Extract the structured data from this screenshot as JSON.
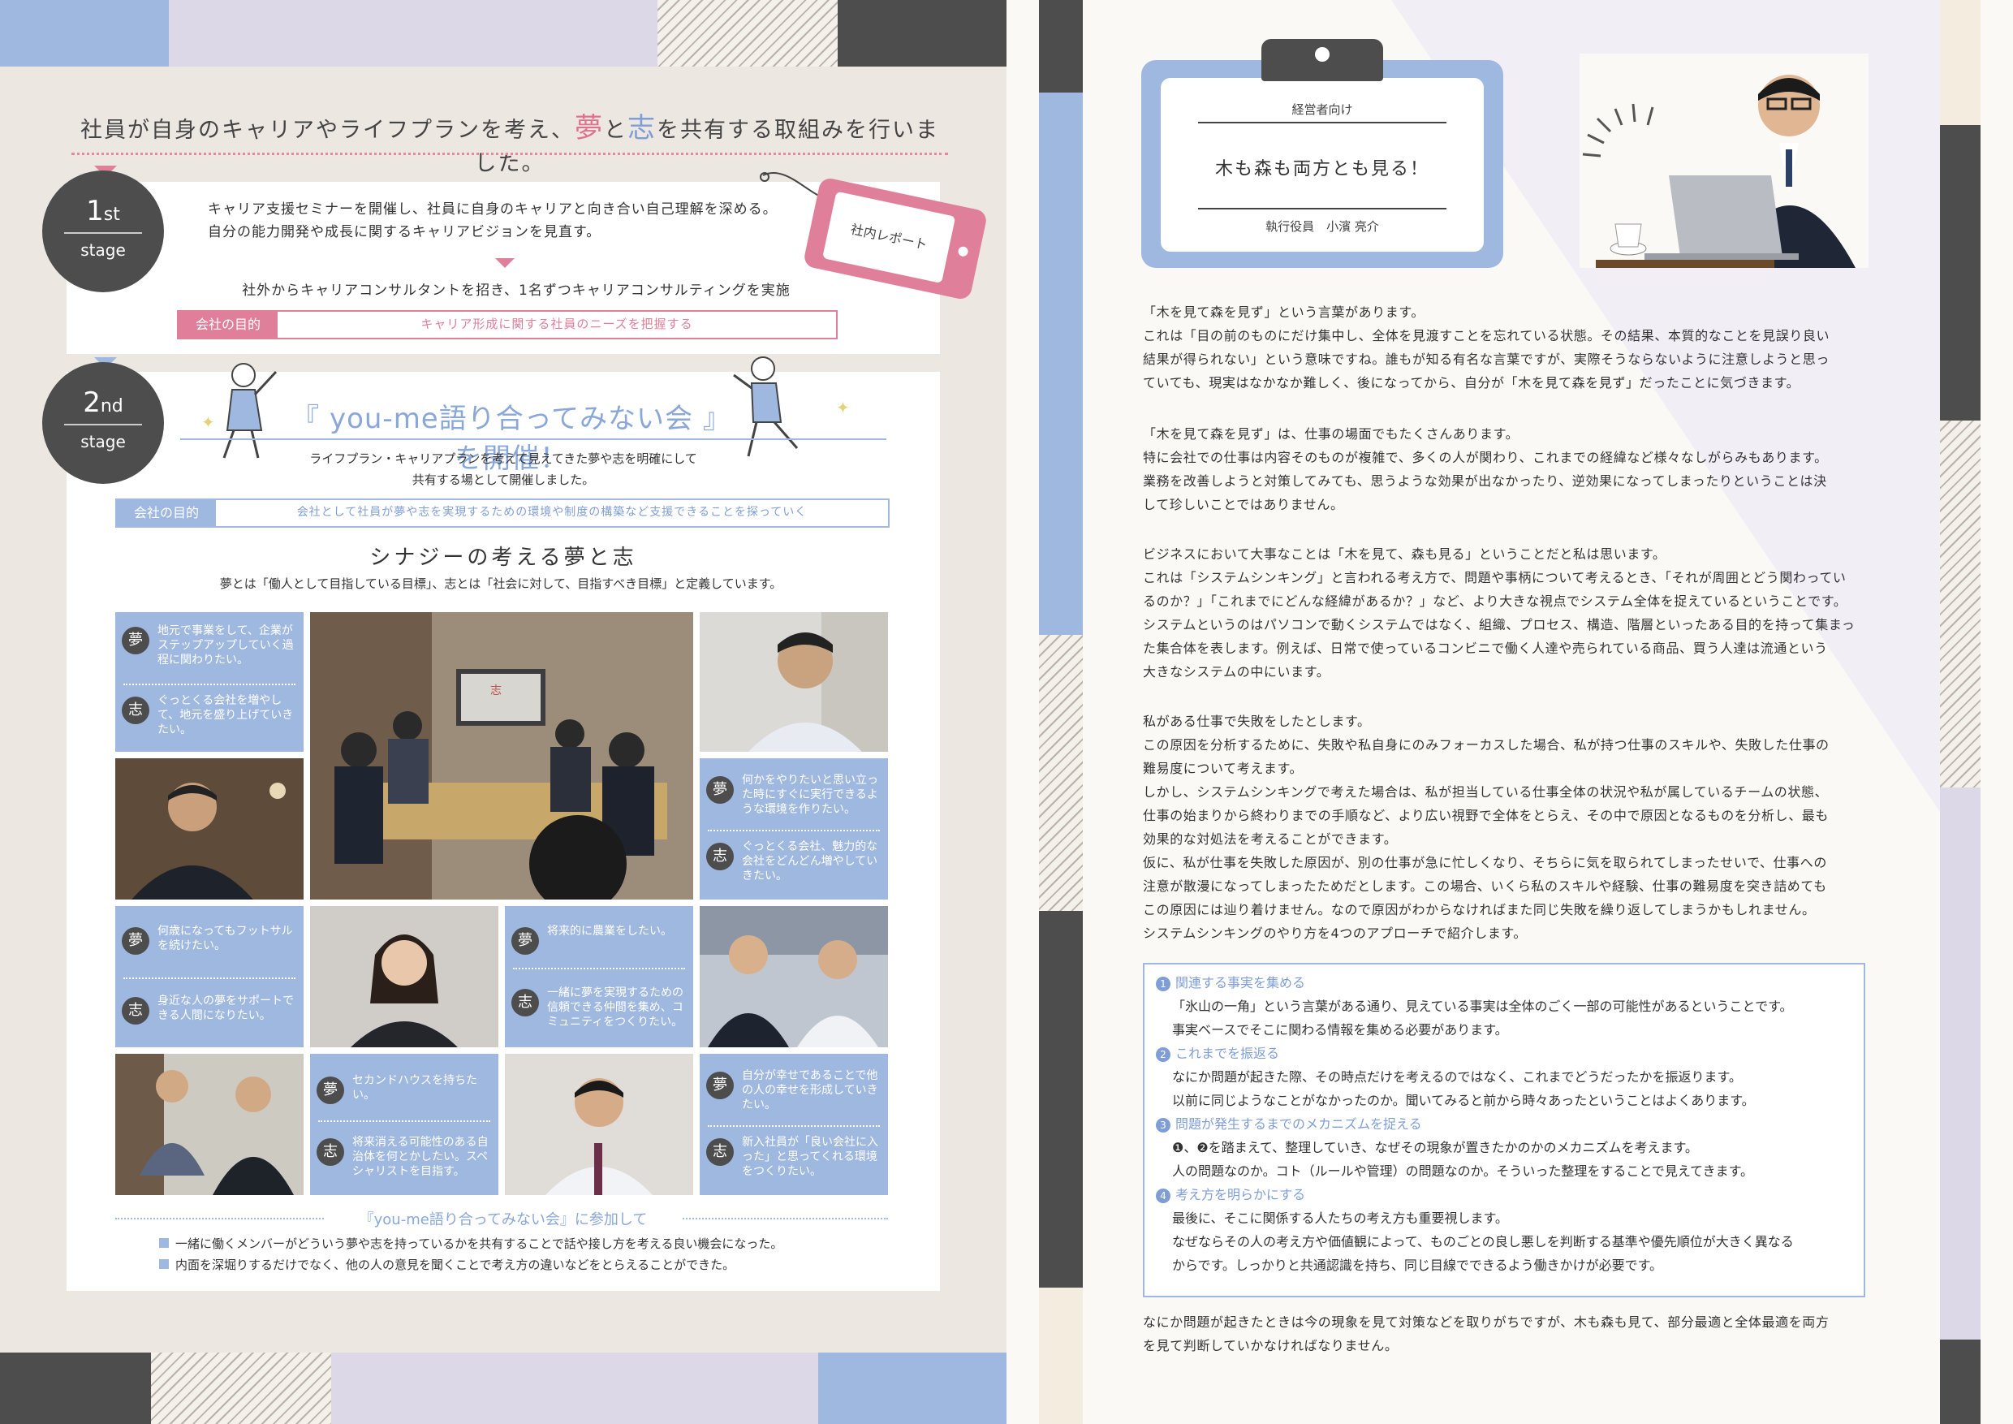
{
  "left": {
    "heading": {
      "pre": "社員が自身のキャリアやライフプランを考え、",
      "yume": "夢",
      "to": "と",
      "kokorozashi": "志",
      "post": "を共有する取組みを行いました。"
    },
    "stage1": {
      "num": "1",
      "suffix": "st",
      "label": "stage",
      "lines": [
        "キャリア支援セミナーを開催し、社員に自身のキャリアと向き合い自己理解を深める。",
        "自分の能力開発や成長に関するキャリアビジョンを見直す。"
      ],
      "sub": "社外からキャリアコンサルタントを招き、1名ずつキャリアコンサルティングを実施",
      "purpose_label": "会社の目的",
      "purpose_value": "キャリア形成に関する社員のニーズを把握する",
      "tag": "社内レポート"
    },
    "stage2": {
      "num": "2",
      "suffix": "nd",
      "label": "stage",
      "title": "『 you-me語り合ってみない会 』を開催！",
      "lines": [
        "ライフプラン・キャリアプランを考えて見えてきた夢や志を明確にして",
        "共有する場として開催しました。"
      ],
      "purpose_label": "会社の目的",
      "purpose_value": "会社として社員が夢や志を実現するための環境や制度の構築など支援できることを探っていく",
      "synergy": "シナジーの考える夢と志",
      "definition": "夢とは「働人として目指している目標」、志とは「社会に対して、目指すべき目標」と定義しています。"
    },
    "cards": [
      {
        "yume": "地元で事業をして、企業がステップアップしていく過程に関わりたい。",
        "shi": "ぐっとくる会社を増やして、地元を盛り上げていきたい。"
      },
      {
        "yume": "何かをやりたいと思い立った時にすぐに実行できるような環境を作りたい。",
        "shi": "ぐっとくる会社、魅力的な会社をどんどん増やしていきたい。"
      },
      {
        "yume": "何歳になってもフットサルを続けたい。",
        "shi": "身近な人の夢をサポートできる人間になりたい。"
      },
      {
        "yume": "将来的に農業をしたい。",
        "shi": "一緒に夢を実現するための信頼できる仲間を集め、コミュニティをつくりたい。"
      },
      {
        "yume": "セカンドハウスを持ちたい。",
        "shi": "将来消える可能性のある自治体を何とかしたい。スペシャリストを目指す。"
      },
      {
        "yume": "自分が幸せであることで他の人の幸せを形成していきたい。",
        "shi": "新入社員が「良い会社に入った」と思ってくれる環境をつくりたい。"
      }
    ],
    "badge_yume": "夢",
    "badge_shi": "志",
    "photo_chars": {
      "tv": "志"
    },
    "feedback": {
      "title": "『you-me語り合ってみない会』に参加して",
      "items": [
        "一緒に働くメンバーがどういう夢や志を持っているかを共有することで話や接し方を考える良い機会になった。",
        "内面を深堀りするだけでなく、他の人の意見を聞くことで考え方の違いなどをとらえることができた。"
      ]
    }
  },
  "right": {
    "card": {
      "category": "経営者向け",
      "title": "木も森も両方とも見る！",
      "author": "執行役員　小濱 亮介"
    },
    "paragraphs": [
      [
        "「木を見て森を見ず」という言葉があります。",
        "これは「目の前のものにだけ集中し、全体を見渡すことを忘れている状態。その結果、本質的なことを見誤り良い",
        "結果が得られない」という意味ですね。誰もが知る有名な言葉ですが、実際そうならないように注意しようと思っ",
        "ていても、現実はなかなか難しく、後になってから、自分が「木を見て森を見ず」だったことに気づきます。"
      ],
      [
        "「木を見て森を見ず」は、仕事の場面でもたくさんあります。",
        "特に会社での仕事は内容そのものが複雑で、多くの人が関わり、これまでの経緯など様々なしがらみもあります。",
        "業務を改善しようと対策してみても、思うような効果が出なかったり、逆効果になってしまったりということは決",
        "して珍しいことではありません。"
      ],
      [
        "ビジネスにおいて大事なことは「木を見て、森も見る」ということだと私は思います。",
        "これは「システムシンキング」と言われる考え方で、問題や事柄について考えるとき、「それが周囲とどう関わってい",
        "るのか？」「これまでにどんな経緯があるか？」など、より大きな視点でシステム全体を捉えているということです。",
        "システムというのはパソコンで動くシステムではなく、組織、プロセス、構造、階層といったある目的を持って集まっ",
        "た集合体を表します。例えば、日常で使っているコンビニで働く人達や売られている商品、買う人達は流通という",
        "大きなシステムの中にいます。"
      ],
      [
        "私がある仕事で失敗をしたとします。",
        "この原因を分析するために、失敗や私自身にのみフォーカスした場合、私が持つ仕事のスキルや、失敗した仕事の",
        "難易度について考えます。",
        "しかし、システムシンキングで考えた場合は、私が担当している仕事全体の状況や私が属しているチームの状態、",
        "仕事の始まりから終わりまでの手順など、より広い視野で全体をとらえ、その中で原因となるものを分析し、最も",
        "効果的な対処法を考えることができます。",
        "仮に、私が仕事を失敗した原因が、別の仕事が急に忙しくなり、そちらに気を取られてしまったせいで、仕事への",
        "注意が散漫になってしまったためだとします。この場合、いくら私のスキルや経験、仕事の難易度を突き詰めても",
        "この原因には辿り着けません。なので原因がわからなければまた同じ失敗を繰り返してしまうかもしれません。",
        "システムシンキングのやり方を4つのアプローチで紹介します。"
      ]
    ],
    "approaches": [
      {
        "n": "1",
        "title": "関連する事実を集める",
        "lines": [
          "「氷山の一角」という言葉がある通り、見えている事実は全体のごく一部の可能性があるということです。",
          "事実ベースでそこに関わる情報を集める必要があります。"
        ]
      },
      {
        "n": "2",
        "title": "これまでを振返る",
        "lines": [
          "なにか問題が起きた際、その時点だけを考えるのではなく、これまでどうだったかを振返ります。",
          "以前に同じようなことがなかったのか。聞いてみると前から時々あったということはよくあります。"
        ]
      },
      {
        "n": "3",
        "title": "問題が発生するまでのメカニズムを捉える",
        "lines": [
          "❶、❷を踏まえて、整理していき、なぜその現象が置きたかのかのメカニズムを考えます。",
          "人の問題なのか。コト（ルールや管理）の問題なのか。そういった整理をすることで見えてきます。"
        ]
      },
      {
        "n": "4",
        "title": "考え方を明らかにする",
        "lines": [
          "最後に、そこに関係する人たちの考え方も重要視します。",
          "なぜならその人の考え方や価値観によって、ものごとの良し悪しを判断する基準や優先順位が大きく異なる",
          "からです。しっかりと共通認識を持ち、同じ目線でできるよう働きかけが必要です。"
        ]
      }
    ],
    "closing": [
      "なにか問題が起きたときは今の現象を見て対策などを取りがちですが、木も森も見て、部分最適と全体最適を両方",
      "を見て判断していかなければなりません。"
    ],
    "laptop_logo": ""
  },
  "colors": {
    "blue": "#9fb8e0",
    "pink": "#e07f99",
    "dark": "#4d4d4d",
    "lavender": "#ddd8e8"
  }
}
